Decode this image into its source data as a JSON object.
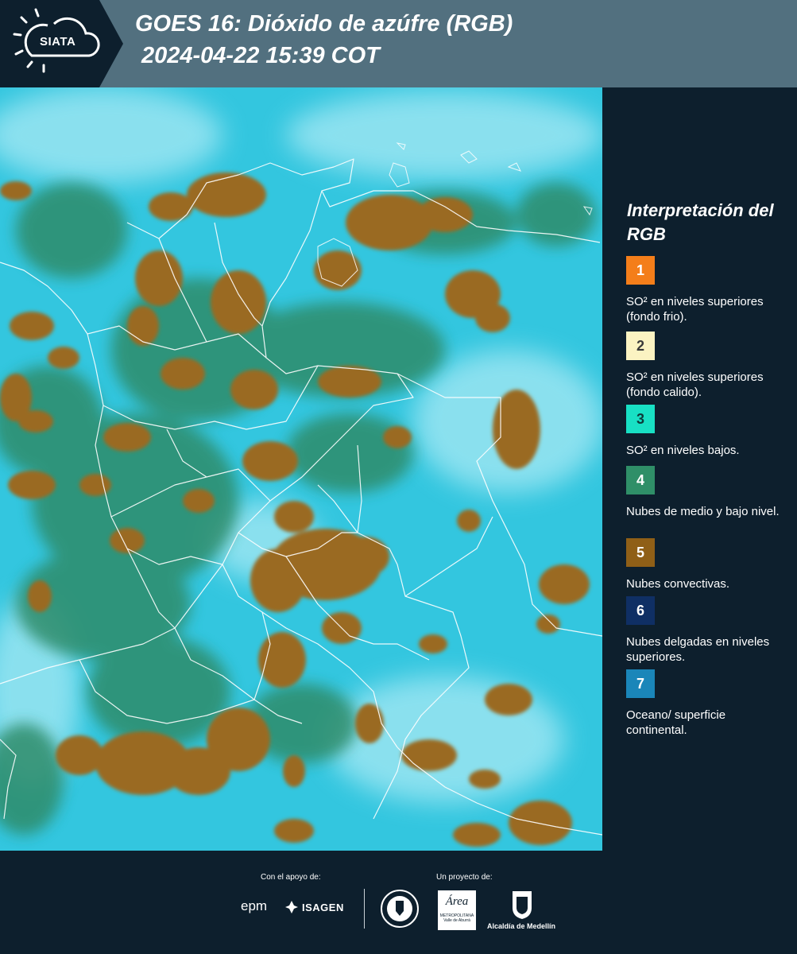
{
  "header": {
    "title_line1": "GOES 16: Dióxido de azúfre (RGB)",
    "title_line2": "2024-04-22 15:39 COT",
    "logo": "SIATA",
    "bg_color": "#52707f"
  },
  "legend": {
    "title": "Interpretación del RGB",
    "items": [
      {
        "number": "1",
        "label": "SO² en niveles superiores (fondo frio).",
        "color": "#f47e1a",
        "text_color": "#ffffff"
      },
      {
        "number": "2",
        "label": "SO² en niveles superiores (fondo calido).",
        "color": "#fbf3c2",
        "text_color": "#3a3a3a"
      },
      {
        "number": "3",
        "label": "SO² en niveles bajos.",
        "color": "#18e0c4",
        "text_color": "#0d3a3a"
      },
      {
        "number": "4",
        "label": "Nubes de medio y bajo nivel.",
        "color": "#2f8f68",
        "text_color": "#ffffff"
      },
      {
        "number": "5",
        "label": "Nubes convectivas.",
        "color": "#8f5f17",
        "text_color": "#ffffff"
      },
      {
        "number": "6",
        "label": "Nubes delgadas en niveles superiores.",
        "color": "#0f2f64",
        "text_color": "#ffffff"
      },
      {
        "number": "7",
        "label": "Oceano/ superficie continental.",
        "color": "#1a86b9",
        "text_color": "#ffffff"
      }
    ]
  },
  "footer": {
    "support_label": "Con el apoyo de:",
    "project_label": "Un proyecto de:",
    "logo_epm": "epm",
    "logo_isagen": "ISAGEN",
    "logo_area": "Área",
    "logo_area_sub": "METROPOLITANA",
    "logo_area_sub2": "Valle de Aburrá",
    "logo_alcaldia": "Alcaldía de Medellín"
  },
  "map": {
    "ocean_color": "#33c6df",
    "cloud_color": "#9a6a22",
    "green_color": "#2e8c6a"
  }
}
